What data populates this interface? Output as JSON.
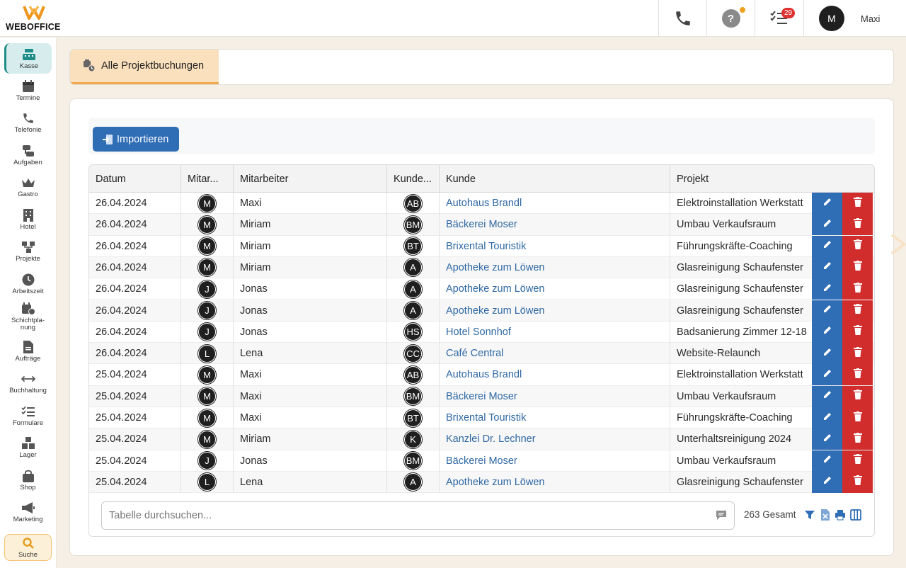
{
  "brand": {
    "name": "WEBOFFICE"
  },
  "topbar": {
    "notification_count": "29",
    "user_initial": "M",
    "user_name": "Maxi"
  },
  "sidebar": {
    "items": [
      {
        "label": "Kasse",
        "icon": "cash-register-icon"
      },
      {
        "label": "Termine",
        "icon": "calendar-icon"
      },
      {
        "label": "Telefonie",
        "icon": "phone-icon"
      },
      {
        "label": "Aufgaben",
        "icon": "tasks-icon"
      },
      {
        "label": "Gastro",
        "icon": "crown-icon"
      },
      {
        "label": "Hotel",
        "icon": "building-icon"
      },
      {
        "label": "Projekte",
        "icon": "sitemap-icon"
      },
      {
        "label": "Arbeitszeit",
        "icon": "clock-icon"
      },
      {
        "label": "Schichtpla-nung",
        "icon": "calendar-clock-icon"
      },
      {
        "label": "Aufträge",
        "icon": "file-icon"
      },
      {
        "label": "Buchhaltung",
        "icon": "arrows-horizontal-icon"
      },
      {
        "label": "Formulare",
        "icon": "list-check-icon"
      },
      {
        "label": "Lager",
        "icon": "boxes-icon"
      },
      {
        "label": "Shop",
        "icon": "shopping-bag-icon"
      },
      {
        "label": "Marketing",
        "icon": "megaphone-icon"
      },
      {
        "label": "Suche",
        "icon": "search-icon"
      }
    ]
  },
  "tabs": [
    {
      "label": "Alle Projektbuchungen"
    }
  ],
  "toolbar": {
    "import_label": "Importieren"
  },
  "table": {
    "columns": [
      "Datum",
      "Mitar...",
      "Mitarbeiter",
      "Kunde...",
      "Kunde",
      "Projekt"
    ],
    "rows": [
      {
        "datum": "26.04.2024",
        "ma_init": "M",
        "mitarbeiter": "Maxi",
        "k_init": "AB",
        "kunde": "Autohaus Brandl",
        "projekt": "Elektroinstallation Werkstatt"
      },
      {
        "datum": "26.04.2024",
        "ma_init": "M",
        "mitarbeiter": "Miriam",
        "k_init": "BM",
        "kunde": "Bäckerei Moser",
        "projekt": "Umbau Verkaufsraum"
      },
      {
        "datum": "26.04.2024",
        "ma_init": "M",
        "mitarbeiter": "Miriam",
        "k_init": "BT",
        "kunde": "Brixental Touristik",
        "projekt": "Führungskräfte-Coaching"
      },
      {
        "datum": "26.04.2024",
        "ma_init": "M",
        "mitarbeiter": "Miriam",
        "k_init": "A",
        "kunde": "Apotheke zum Löwen",
        "projekt": "Glasreinigung Schaufenster"
      },
      {
        "datum": "26.04.2024",
        "ma_init": "J",
        "mitarbeiter": "Jonas",
        "k_init": "A",
        "kunde": "Apotheke zum Löwen",
        "projekt": "Glasreinigung Schaufenster"
      },
      {
        "datum": "26.04.2024",
        "ma_init": "J",
        "mitarbeiter": "Jonas",
        "k_init": "A",
        "kunde": "Apotheke zum Löwen",
        "projekt": "Glasreinigung Schaufenster"
      },
      {
        "datum": "26.04.2024",
        "ma_init": "J",
        "mitarbeiter": "Jonas",
        "k_init": "HS",
        "kunde": "Hotel Sonnhof",
        "projekt": "Badsanierung Zimmer 12-18"
      },
      {
        "datum": "26.04.2024",
        "ma_init": "L",
        "mitarbeiter": "Lena",
        "k_init": "CC",
        "kunde": "Café Central",
        "projekt": "Website-Relaunch"
      },
      {
        "datum": "25.04.2024",
        "ma_init": "M",
        "mitarbeiter": "Maxi",
        "k_init": "AB",
        "kunde": "Autohaus Brandl",
        "projekt": "Elektroinstallation Werkstatt"
      },
      {
        "datum": "25.04.2024",
        "ma_init": "M",
        "mitarbeiter": "Maxi",
        "k_init": "BM",
        "kunde": "Bäckerei Moser",
        "projekt": "Umbau Verkaufsraum"
      },
      {
        "datum": "25.04.2024",
        "ma_init": "M",
        "mitarbeiter": "Maxi",
        "k_init": "BT",
        "kunde": "Brixental Touristik",
        "projekt": "Führungskräfte-Coaching"
      },
      {
        "datum": "25.04.2024",
        "ma_init": "M",
        "mitarbeiter": "Miriam",
        "k_init": "K",
        "kunde": "Kanzlei Dr. Lechner",
        "projekt": "Unterhaltsreinigung 2024"
      },
      {
        "datum": "25.04.2024",
        "ma_init": "J",
        "mitarbeiter": "Jonas",
        "k_init": "BM",
        "kunde": "Bäckerei Moser",
        "projekt": "Umbau Verkaufsraum"
      },
      {
        "datum": "25.04.2024",
        "ma_init": "L",
        "mitarbeiter": "Lena",
        "k_init": "A",
        "kunde": "Apotheke zum Löwen",
        "projekt": "Glasreinigung Schaufenster"
      }
    ]
  },
  "footer": {
    "search_placeholder": "Tabelle durchsuchen...",
    "total": "263 Gesamt"
  },
  "colors": {
    "primary": "#2f6db5",
    "danger": "#d12d2d",
    "accent": "#f0a94c",
    "link": "#2e68a3"
  }
}
